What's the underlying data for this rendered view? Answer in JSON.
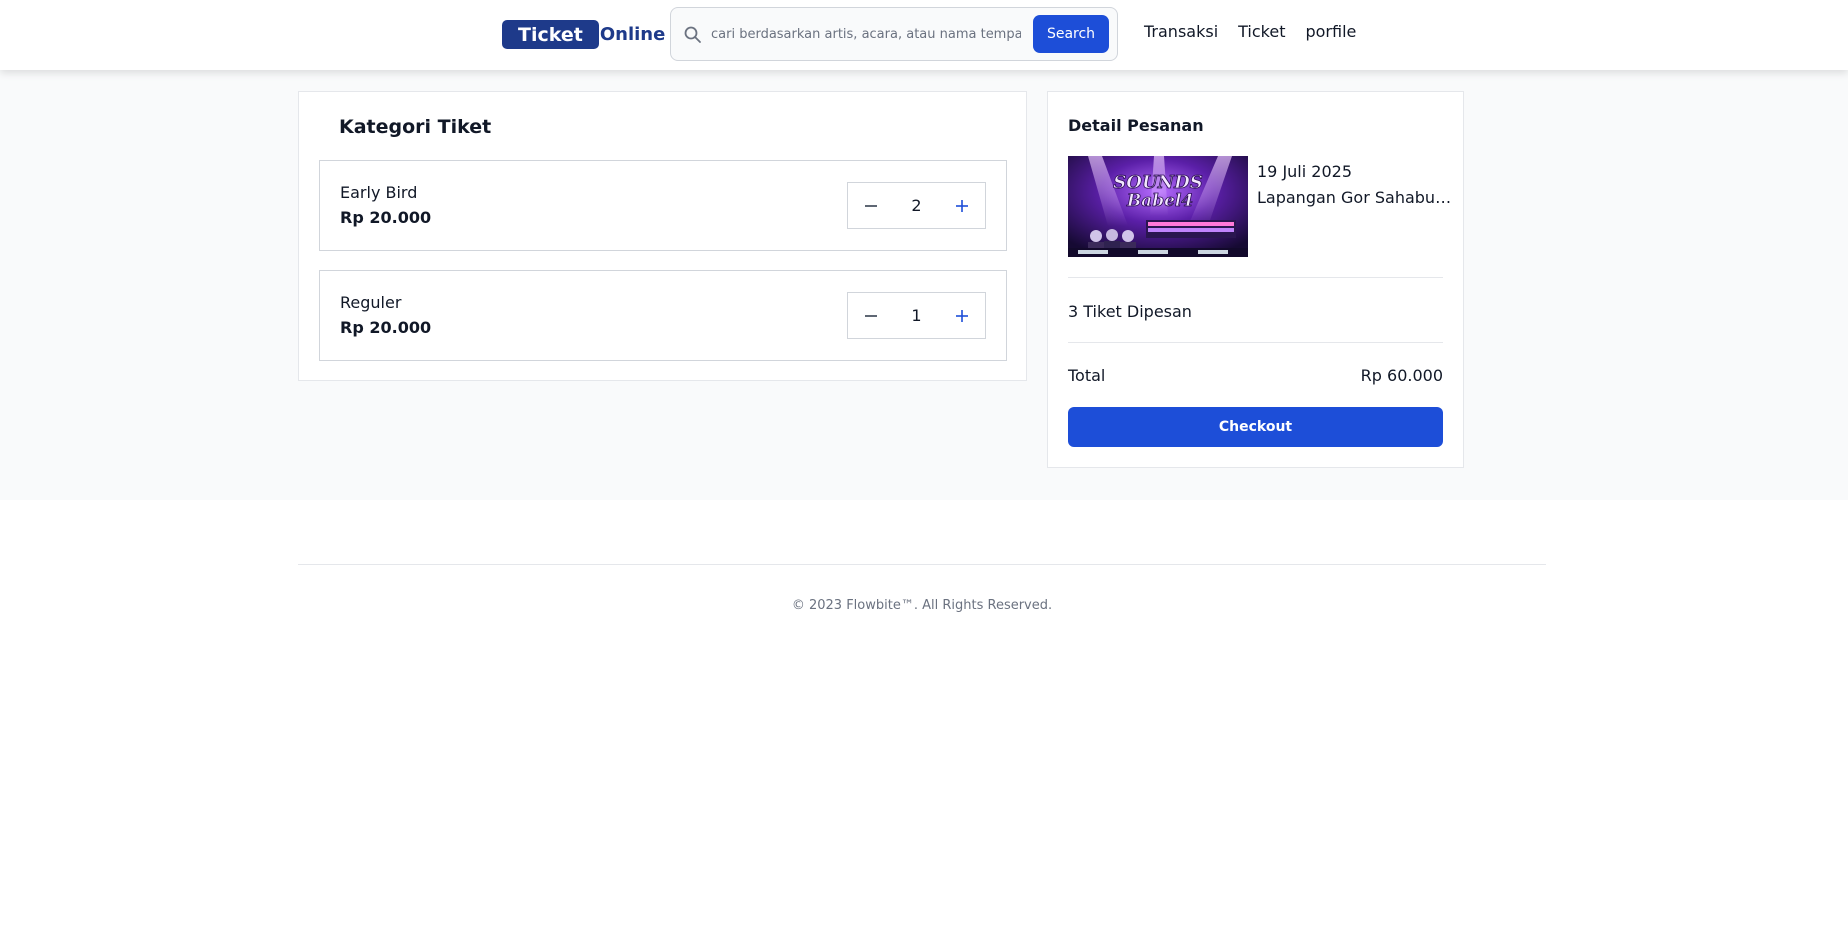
{
  "header": {
    "logo_ticket": "Ticket",
    "logo_online": "Online",
    "search_placeholder": "cari berdasarkan artis, acara, atau nama tempat",
    "search_button": "Search",
    "nav": [
      "Transaksi",
      "Ticket",
      "porfile"
    ]
  },
  "category": {
    "title": "Kategori Tiket",
    "tickets": [
      {
        "name": "Early Bird",
        "price": "Rp 20.000",
        "quantity": "2"
      },
      {
        "name": "Reguler",
        "price": "Rp 20.000",
        "quantity": "1"
      }
    ]
  },
  "order": {
    "title": "Detail Pesanan",
    "event_image": "Sounds of Babel 4 event poster",
    "date": "19 Juli 2025",
    "venue": "Lapangan Gor Sahabudin Lapangan",
    "count_text": "3 Tiket Dipesan",
    "total_label": "Total",
    "total_value": "Rp 60.000",
    "checkout_label": "Checkout"
  },
  "footer": {
    "copyright": "© 2023 Flowbite™. All Rights Reserved."
  },
  "colors": {
    "brand": "#1e3a8a",
    "primary": "#1d4ed8"
  }
}
